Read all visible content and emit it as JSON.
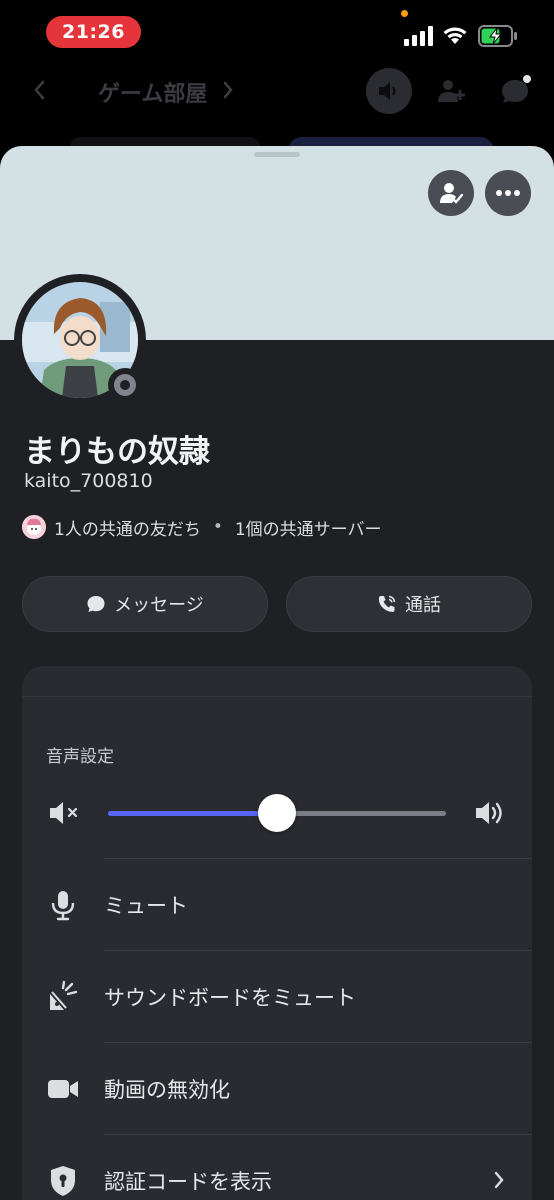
{
  "status_bar": {
    "time": "21:26"
  },
  "background_header": {
    "channel_title": "ゲーム部屋"
  },
  "profile": {
    "display_name": "まりもの奴隷",
    "username": "kaito_700810",
    "mutual_friends": "1人の共通の友だち",
    "separator": "•",
    "mutual_servers": "1個の共通サーバー"
  },
  "actions": {
    "message_label": "メッセージ",
    "call_label": "通話"
  },
  "voice_settings": {
    "section_label": "音声設定",
    "volume_level": 0.5
  },
  "menu": {
    "items": [
      {
        "label": "ミュート",
        "icon": "microphone-icon"
      },
      {
        "label": "サウンドボードをミュート",
        "icon": "soundboard-icon"
      },
      {
        "label": "動画の無効化",
        "icon": "video-camera-icon"
      },
      {
        "label": "認証コードを表示",
        "icon": "shield-lock-icon",
        "has_chevron": true
      }
    ]
  },
  "colors": {
    "accent": "#5865f2",
    "banner": "#d4e1e4",
    "time_pill": "#e5353a",
    "sheet_bg": "#1f2024",
    "card_bg": "#2a2b31"
  }
}
